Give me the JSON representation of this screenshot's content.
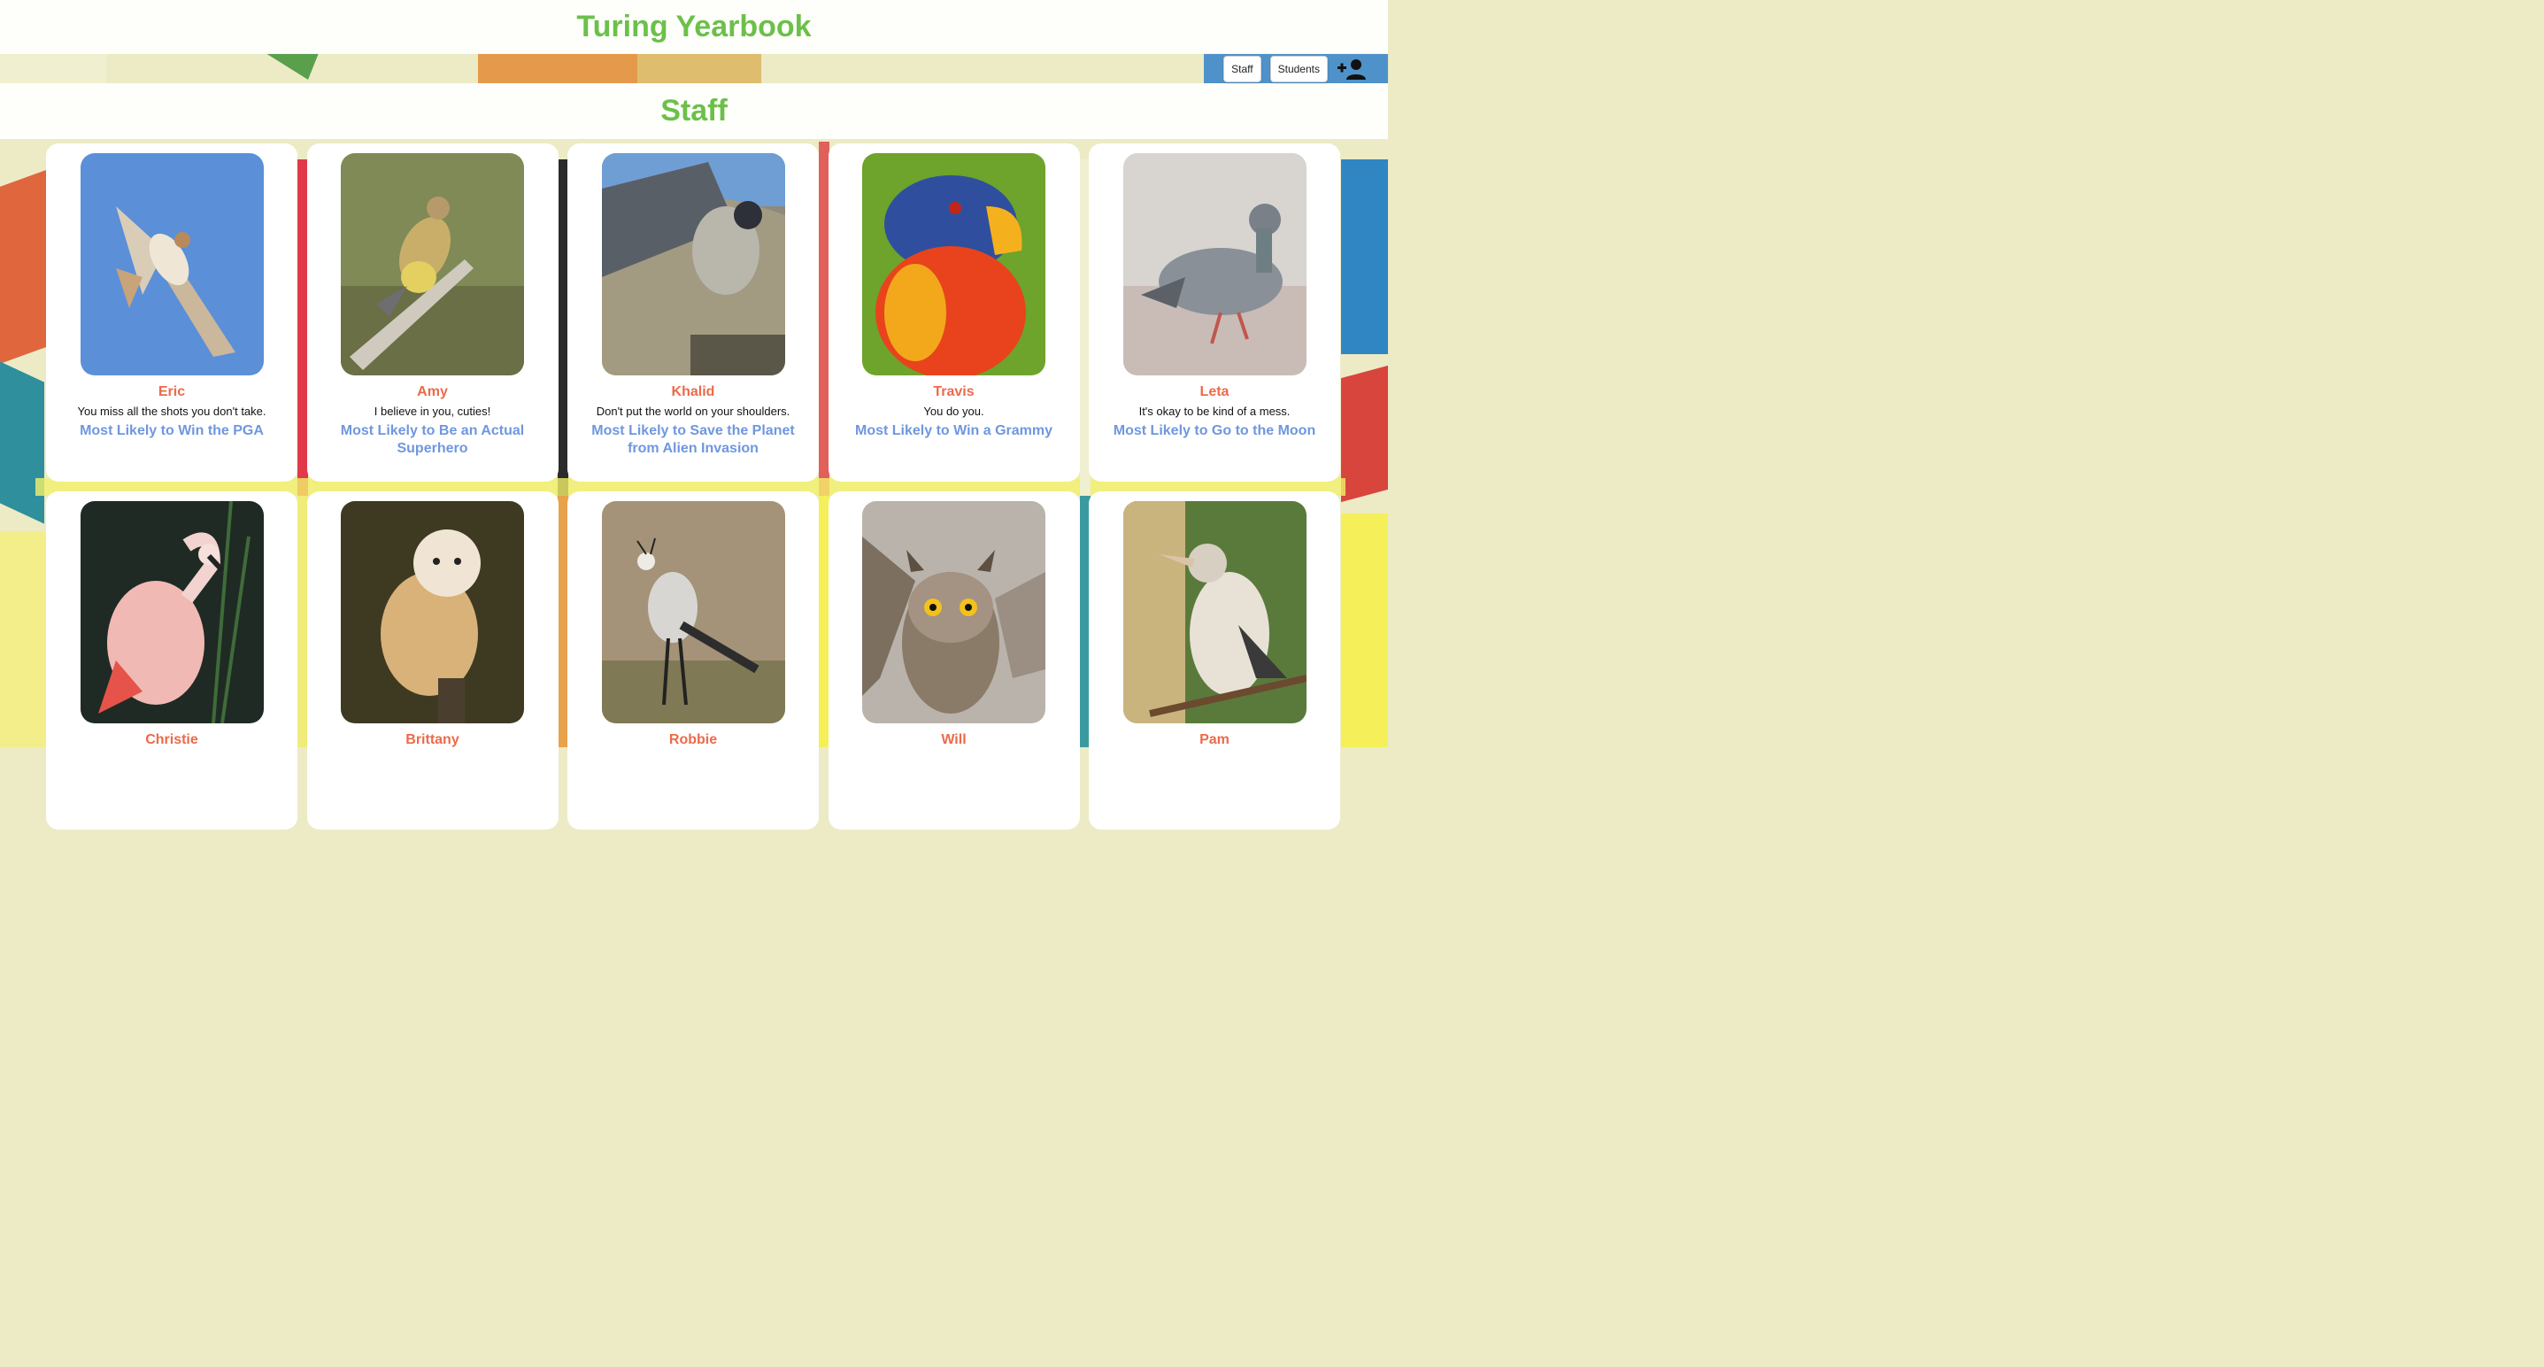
{
  "site": {
    "title": "Turing Yearbook"
  },
  "nav": {
    "staff_label": "Staff",
    "students_label": "Students",
    "add_icon": "add-person-icon"
  },
  "section": {
    "title": "Staff"
  },
  "staff": [
    {
      "name": "Eric",
      "quote": "You miss all the shots you don't take.",
      "superlative": "Most Likely to Win the PGA",
      "photo": "hawk-photo"
    },
    {
      "name": "Amy",
      "quote": "I believe in you, cuties!",
      "superlative": "Most Likely to Be an Actual Superhero",
      "photo": "waxwing-photo"
    },
    {
      "name": "Khalid",
      "quote": "Don't put the world on your shoulders.",
      "superlative": "Most Likely to Save the Planet from Alien Invasion",
      "photo": "falcon-photo"
    },
    {
      "name": "Travis",
      "quote": "You do you.",
      "superlative": "Most Likely to Win a Grammy",
      "photo": "lorikeet-photo"
    },
    {
      "name": "Leta",
      "quote": "It's okay to be kind of a mess.",
      "superlative": "Most Likely to Go to the Moon",
      "photo": "pigeon-photo"
    },
    {
      "name": "Christie",
      "photo": "flamingo-photo"
    },
    {
      "name": "Brittany",
      "photo": "barn-owl-photo"
    },
    {
      "name": "Robbie",
      "photo": "secretary-bird-photo"
    },
    {
      "name": "Will",
      "photo": "horned-owl-photo"
    },
    {
      "name": "Pam",
      "photo": "kookaburra-photo"
    }
  ]
}
